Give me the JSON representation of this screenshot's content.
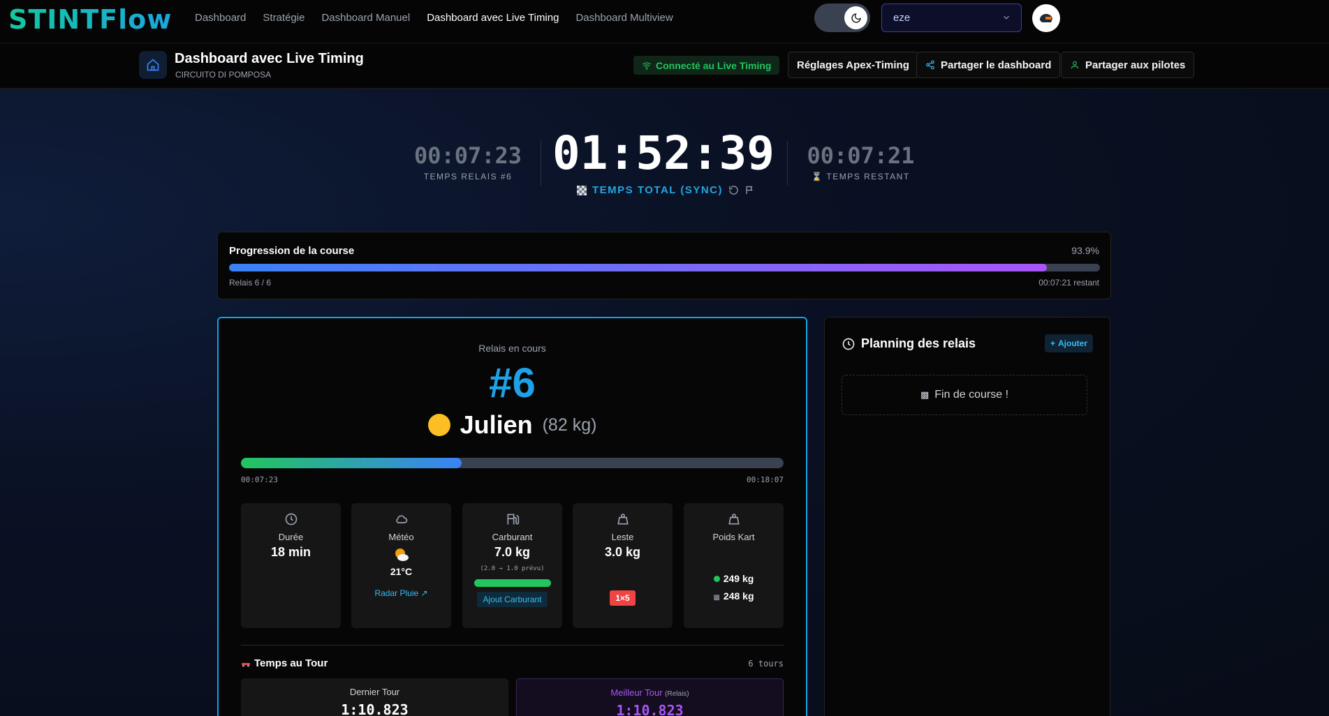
{
  "nav": {
    "logo": "STINTFlow",
    "links": [
      "Dashboard",
      "Stratégie",
      "Dashboard Manuel",
      "Dashboard avec Live Timing",
      "Dashboard Multiview"
    ],
    "active_index": 3,
    "selector_value": "eze",
    "theme": "dark"
  },
  "header": {
    "title": "Dashboard avec Live Timing",
    "subtitle": "CIRCUITO DI POMPOSA",
    "connected_label": "Connecté au Live Timing",
    "apex_button": "Réglages Apex-Timing",
    "share_button": "Partager le dashboard",
    "drivers_button": "Partager aux pilotes"
  },
  "timers": {
    "stint_time": "00:07:23",
    "stint_label": "TEMPS RELAIS #6",
    "total_time": "01:52:39",
    "total_label": "TEMPS TOTAL (SYNC)",
    "remaining_time": "00:07:21",
    "remaining_label": "TEMPS RESTANT"
  },
  "progression": {
    "title": "Progression de la course",
    "percent_label": "93.9%",
    "percent": 93.9,
    "stints_label": "Relais 6 / 6",
    "remaining_label": "00:07:21 restant"
  },
  "stint": {
    "label": "Relais en cours",
    "number": "#6",
    "driver_name": "Julien",
    "driver_weight": "(82 kg)",
    "driver_color": "#fbbf24",
    "progress_fraction": 0.407,
    "elapsed": "00:07:23",
    "planned": "00:18:07",
    "tiles": {
      "duration": {
        "label": "Durée",
        "value": "18 min"
      },
      "weather": {
        "label": "Météo",
        "temp": "21°C",
        "link": "Radar Pluie ↗"
      },
      "fuel": {
        "label": "Carburant",
        "value": "7.0 kg",
        "detail": "(2.0 → 1.0 prévu)",
        "button": "Ajout Carburant"
      },
      "ballast": {
        "label": "Leste",
        "value": "3.0 kg",
        "badge": "1×5"
      },
      "kart_weight": {
        "label": "Poids Kart",
        "current": "249 kg",
        "target": "248 kg"
      }
    },
    "laps": {
      "title": "Temps au Tour",
      "count": "6 tours",
      "last_label": "Dernier Tour",
      "last_value": "1:10.823",
      "best_label": "Meilleur Tour",
      "best_suffix": "(Relais)",
      "best_value": "1:10.823"
    }
  },
  "planning": {
    "title": "Planning des relais",
    "add_button": "Ajouter",
    "end_label": "Fin de course !"
  }
}
